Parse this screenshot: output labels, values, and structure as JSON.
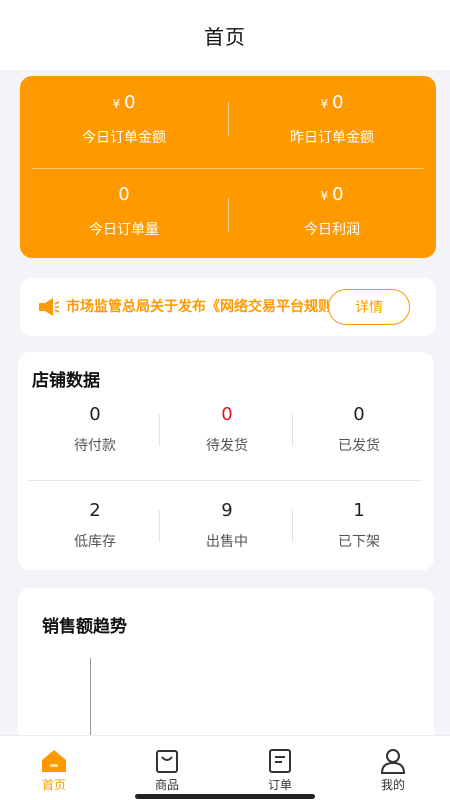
{
  "header": {
    "title": "首页"
  },
  "overview": {
    "today_amount": {
      "currency": "¥",
      "value": "0",
      "label": "今日订单金额"
    },
    "yesterday_amount": {
      "currency": "¥",
      "value": "0",
      "label": "昨日订单金额"
    },
    "today_count": {
      "value": "0",
      "label": "今日订单量"
    },
    "today_profit": {
      "currency": "¥",
      "value": "0",
      "label": "今日利润"
    }
  },
  "notice": {
    "text": "市场监管总局关于发布《网络交易平台规则",
    "button": "详情"
  },
  "store": {
    "title": "店铺数据",
    "stats": [
      {
        "value": "0",
        "label": "待付款"
      },
      {
        "value": "0",
        "label": "待发货"
      },
      {
        "value": "0",
        "label": "已发货"
      },
      {
        "value": "2",
        "label": "低库存"
      },
      {
        "value": "9",
        "label": "出售中"
      },
      {
        "value": "1",
        "label": "已下架"
      }
    ]
  },
  "sales": {
    "title": "销售额趋势"
  },
  "tabbar": {
    "items": [
      {
        "label": "首页",
        "icon": "home-icon"
      },
      {
        "label": "商品",
        "icon": "bag-icon"
      },
      {
        "label": "订单",
        "icon": "order-icon"
      },
      {
        "label": "我的",
        "icon": "user-icon"
      }
    ]
  },
  "colors": {
    "accent": "#fe9a00",
    "alert": "#e0141e",
    "background": "#f3f4f8"
  }
}
